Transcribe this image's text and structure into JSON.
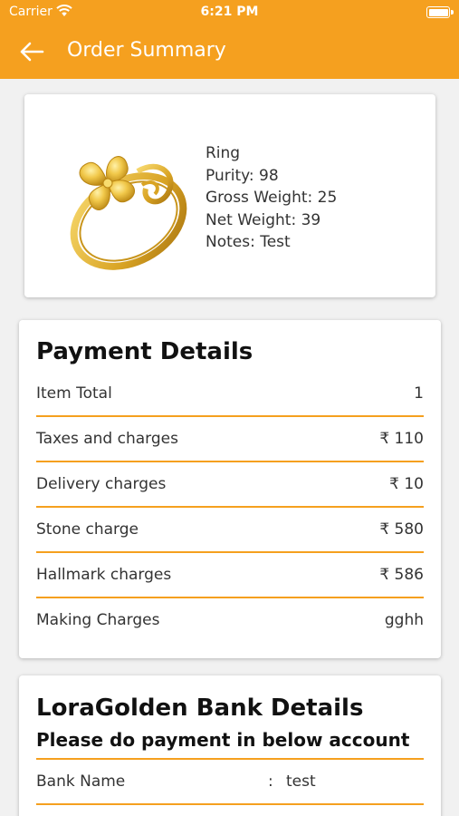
{
  "status_bar": {
    "carrier": "Carrier",
    "time": "6:21 PM"
  },
  "nav": {
    "title": "Order Summary",
    "back_icon": "arrow-left-icon"
  },
  "colors": {
    "accent": "#f5a01f",
    "background": "#f1f1f1",
    "card": "#ffffff"
  },
  "product": {
    "name": "Ring",
    "purity": "Purity: 98",
    "gross_weight": "Gross Weight: 25",
    "net_weight": "Net Weight: 39",
    "notes": "Notes: Test"
  },
  "payment": {
    "title": "Payment Details",
    "rows": [
      {
        "label": "Item Total",
        "value": "1"
      },
      {
        "label": "Taxes and charges",
        "value": "₹ 110"
      },
      {
        "label": "Delivery charges",
        "value": "₹ 10"
      },
      {
        "label": "Stone charge",
        "value": "₹ 580"
      },
      {
        "label": "Hallmark charges",
        "value": "₹ 586"
      },
      {
        "label": "Making Charges",
        "value": "gghh"
      }
    ]
  },
  "bank": {
    "title": "LoraGolden Bank Details",
    "subtitle": "Please do payment in below account",
    "rows": [
      {
        "label": "Bank Name",
        "separator": ":",
        "value": "test"
      }
    ]
  }
}
